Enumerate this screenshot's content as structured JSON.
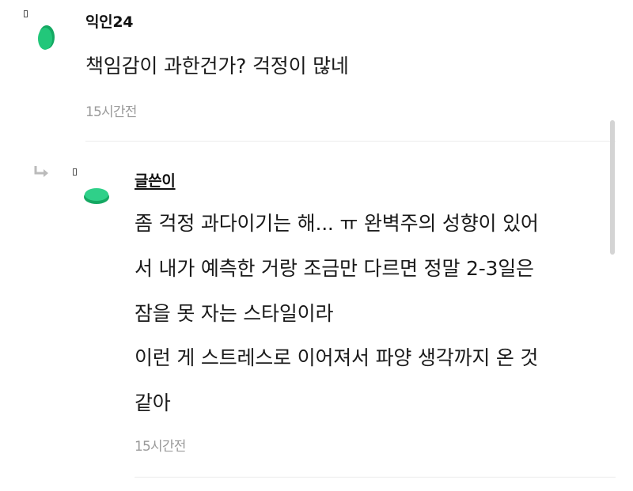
{
  "comment": {
    "nickname": "익인24",
    "text": "책임감이 과한건가? 걱정이 많네",
    "time": "15시간전"
  },
  "reply": {
    "nickname": "글쓴이",
    "lines": [
      "좀 걱정 과다이기는 해... ㅠ 완벽주의 성향이 있어",
      "서 내가 예측한 거랑 조금만 다르면 정말 2-3일은",
      "잠을 못 자는 스타일이라",
      "이런 게 스트레스로 이어져서 파양 생각까지 온 것",
      "같아"
    ],
    "time": "15시간전"
  },
  "colors": {
    "avatar_green": "#22c77a",
    "avatar_green_dark": "#14a862",
    "divider": "#ebebeb",
    "timestamp": "#9a9a9a"
  },
  "icons": [
    "reply-arrow-icon",
    "missing-glyph-icon",
    "avatar-icon"
  ]
}
